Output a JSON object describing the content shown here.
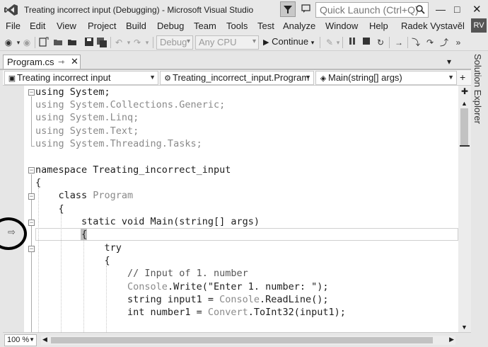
{
  "window": {
    "title": "Treating incorrect input (Debugging) - Microsoft Visual Studio",
    "quick_launch_placeholder": "Quick Launch (Ctrl+Q)",
    "user_name": "Radek Vystavěl",
    "user_initials": "RV"
  },
  "menu": [
    "File",
    "Edit",
    "View",
    "Project",
    "Build",
    "Debug",
    "Team",
    "Tools",
    "Test",
    "Analyze",
    "Window",
    "Help"
  ],
  "toolbar": {
    "config": "Debug",
    "platform": "Any CPU",
    "continue_label": "Continue"
  },
  "tab": {
    "name": "Program.cs"
  },
  "side_panel": {
    "label": "Solution Explorer"
  },
  "navbar": {
    "project": "Treating incorrect input",
    "class": "Treating_incorrect_input.Program",
    "member": "Main(string[] args)"
  },
  "code": [
    "using System;",
    "using System.Collections.Generic;",
    "using System.Linq;",
    "using System.Text;",
    "using System.Threading.Tasks;",
    "",
    "namespace Treating_incorrect_input",
    "{",
    "    class Program",
    "    {",
    "        static void Main(string[] args)",
    "        {",
    "            try",
    "            {",
    "                // Input of 1. number",
    "                Console.Write(\"Enter 1. number: \");",
    "                string input1 = Console.ReadLine();",
    "                int number1 = Convert.ToInt32(input1);"
  ],
  "zoom": "100 %",
  "colors": {
    "editor_bg": "#ffffff",
    "chrome_bg": "#e6e6e6",
    "inactive_code": "#8a8a8a"
  }
}
